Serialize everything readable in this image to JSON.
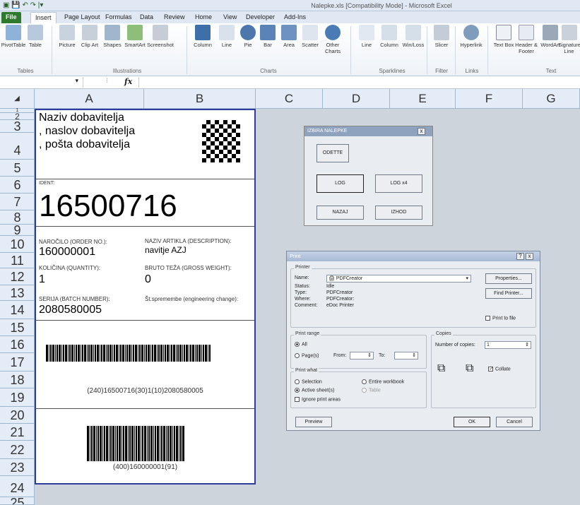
{
  "window": {
    "title": "Nalepke.xls  [Compatibility Mode]  -  Microsoft Excel"
  },
  "tabs": [
    "File",
    "Insert",
    "Page Layout",
    "Formulas",
    "Data",
    "Review",
    "Home",
    "View",
    "Developer",
    "Add-Ins"
  ],
  "ribbon": {
    "buttons": [
      "PivotTable",
      "Table",
      "Picture",
      "Clip Art",
      "Shapes",
      "SmartArt",
      "Screenshot",
      "Column",
      "Line",
      "Pie",
      "Bar",
      "Area",
      "Scatter",
      "Other Charts",
      "Line",
      "Column",
      "Win/Loss",
      "Slicer",
      "Hyperlink",
      "Text Box",
      "Header & Footer",
      "WordArt",
      "Signature Line"
    ],
    "groups": [
      "Tables",
      "Illustrations",
      "Charts",
      "Sparklines",
      "Filter",
      "Links",
      "Text"
    ]
  },
  "formula_bar": {
    "fx": "fx"
  },
  "columns": [
    "A",
    "B",
    "C",
    "D",
    "E",
    "F",
    "G"
  ],
  "rows": [
    "1",
    "2",
    "3",
    "4",
    "5",
    "6",
    "7",
    "8",
    "9",
    "10",
    "11",
    "12",
    "13",
    "14",
    "15",
    "16",
    "17",
    "18",
    "19",
    "20",
    "21",
    "22",
    "23",
    "24",
    "25"
  ],
  "label": {
    "supplier_line1": "Naziv  dobavitelja",
    "supplier_line2": ", naslov  dobavitelja",
    "supplier_line3": ", pošta  dobavitelja",
    "ident_label": "IDENT:",
    "ident_value": "16500716",
    "order_label": "NAROČILO (ORDER NO.):",
    "order_value": "160000001",
    "desc_label": "NAZIV ARTIKLA (DESCRIPTION):",
    "desc_value": "navitje AZJ",
    "qty_label": "KOLIČINA (QUANTITY):",
    "qty_value": "1",
    "weight_label": "BRUTO TEŽA (GROSS WEIGHT):",
    "weight_value": "0",
    "batch_label": "SERIJA (BATCH NUMBER):",
    "batch_value": "2080580005",
    "change_label": "Št.spremembe (engineering change):",
    "barcode1_text": "(240)16500716(30)1(10)2080580005",
    "barcode2_text": "(400)160000001(91)"
  },
  "dialog_nalepke": {
    "title": "IZBIRA NALEPKE",
    "close": "x",
    "btn_odette": "ODETTE",
    "btn_log": "LOG",
    "btn_logx4": "LOG x4",
    "btn_nazaj": "NAZAJ",
    "btn_izhod": "IZHOD"
  },
  "print_dialog": {
    "title": "Print",
    "help": "?",
    "close": "x",
    "printer_group": "Printer",
    "name_label": "Name:",
    "name_value": "PDFCreator",
    "status_label": "Status:",
    "status_value": "Idle",
    "type_label": "Type:",
    "type_value": "PDFCreator",
    "where_label": "Where:",
    "where_value": "PDFCreator:",
    "comment_label": "Comment:",
    "comment_value": "eDoc Printer",
    "properties_btn": "Properties...",
    "find_printer_btn": "Find Printer...",
    "print_to_file": "Print to file",
    "range_group": "Print range",
    "range_all": "All",
    "range_pages": "Page(s)",
    "from_label": "From:",
    "to_label": "To:",
    "copies_group": "Copies",
    "copies_label": "Number of copies:",
    "copies_value": "1",
    "collate": "Collate",
    "what_group": "Print what",
    "what_selection": "Selection",
    "what_entire": "Entire workbook",
    "what_active": "Active sheet(s)",
    "what_table": "Table",
    "ignore_areas": "Ignore print areas",
    "preview_btn": "Preview",
    "ok_btn": "OK",
    "cancel_btn": "Cancel"
  }
}
